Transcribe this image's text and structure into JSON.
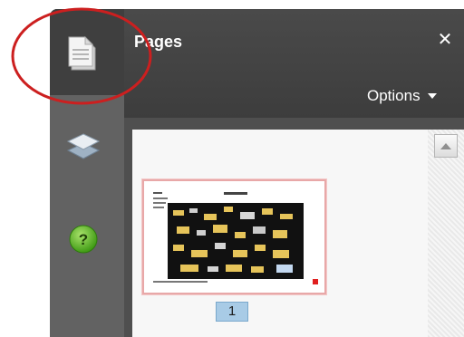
{
  "panel": {
    "title": "Pages",
    "close_icon": "close-icon",
    "options_label": "Options"
  },
  "rail": {
    "items": [
      {
        "name": "pages",
        "icon": "pages-icon",
        "active": true
      },
      {
        "name": "layers",
        "icon": "layers-icon",
        "active": false
      },
      {
        "name": "help",
        "icon": "help-icon",
        "active": false
      }
    ]
  },
  "thumbnails": [
    {
      "page_label": "1"
    }
  ],
  "colors": {
    "panel_dark": "#3f3f3f",
    "rail": "#626262",
    "selection": "#a8cbe6",
    "annotation_red": "#cc1f1f",
    "help_green": "#5bb82a"
  }
}
